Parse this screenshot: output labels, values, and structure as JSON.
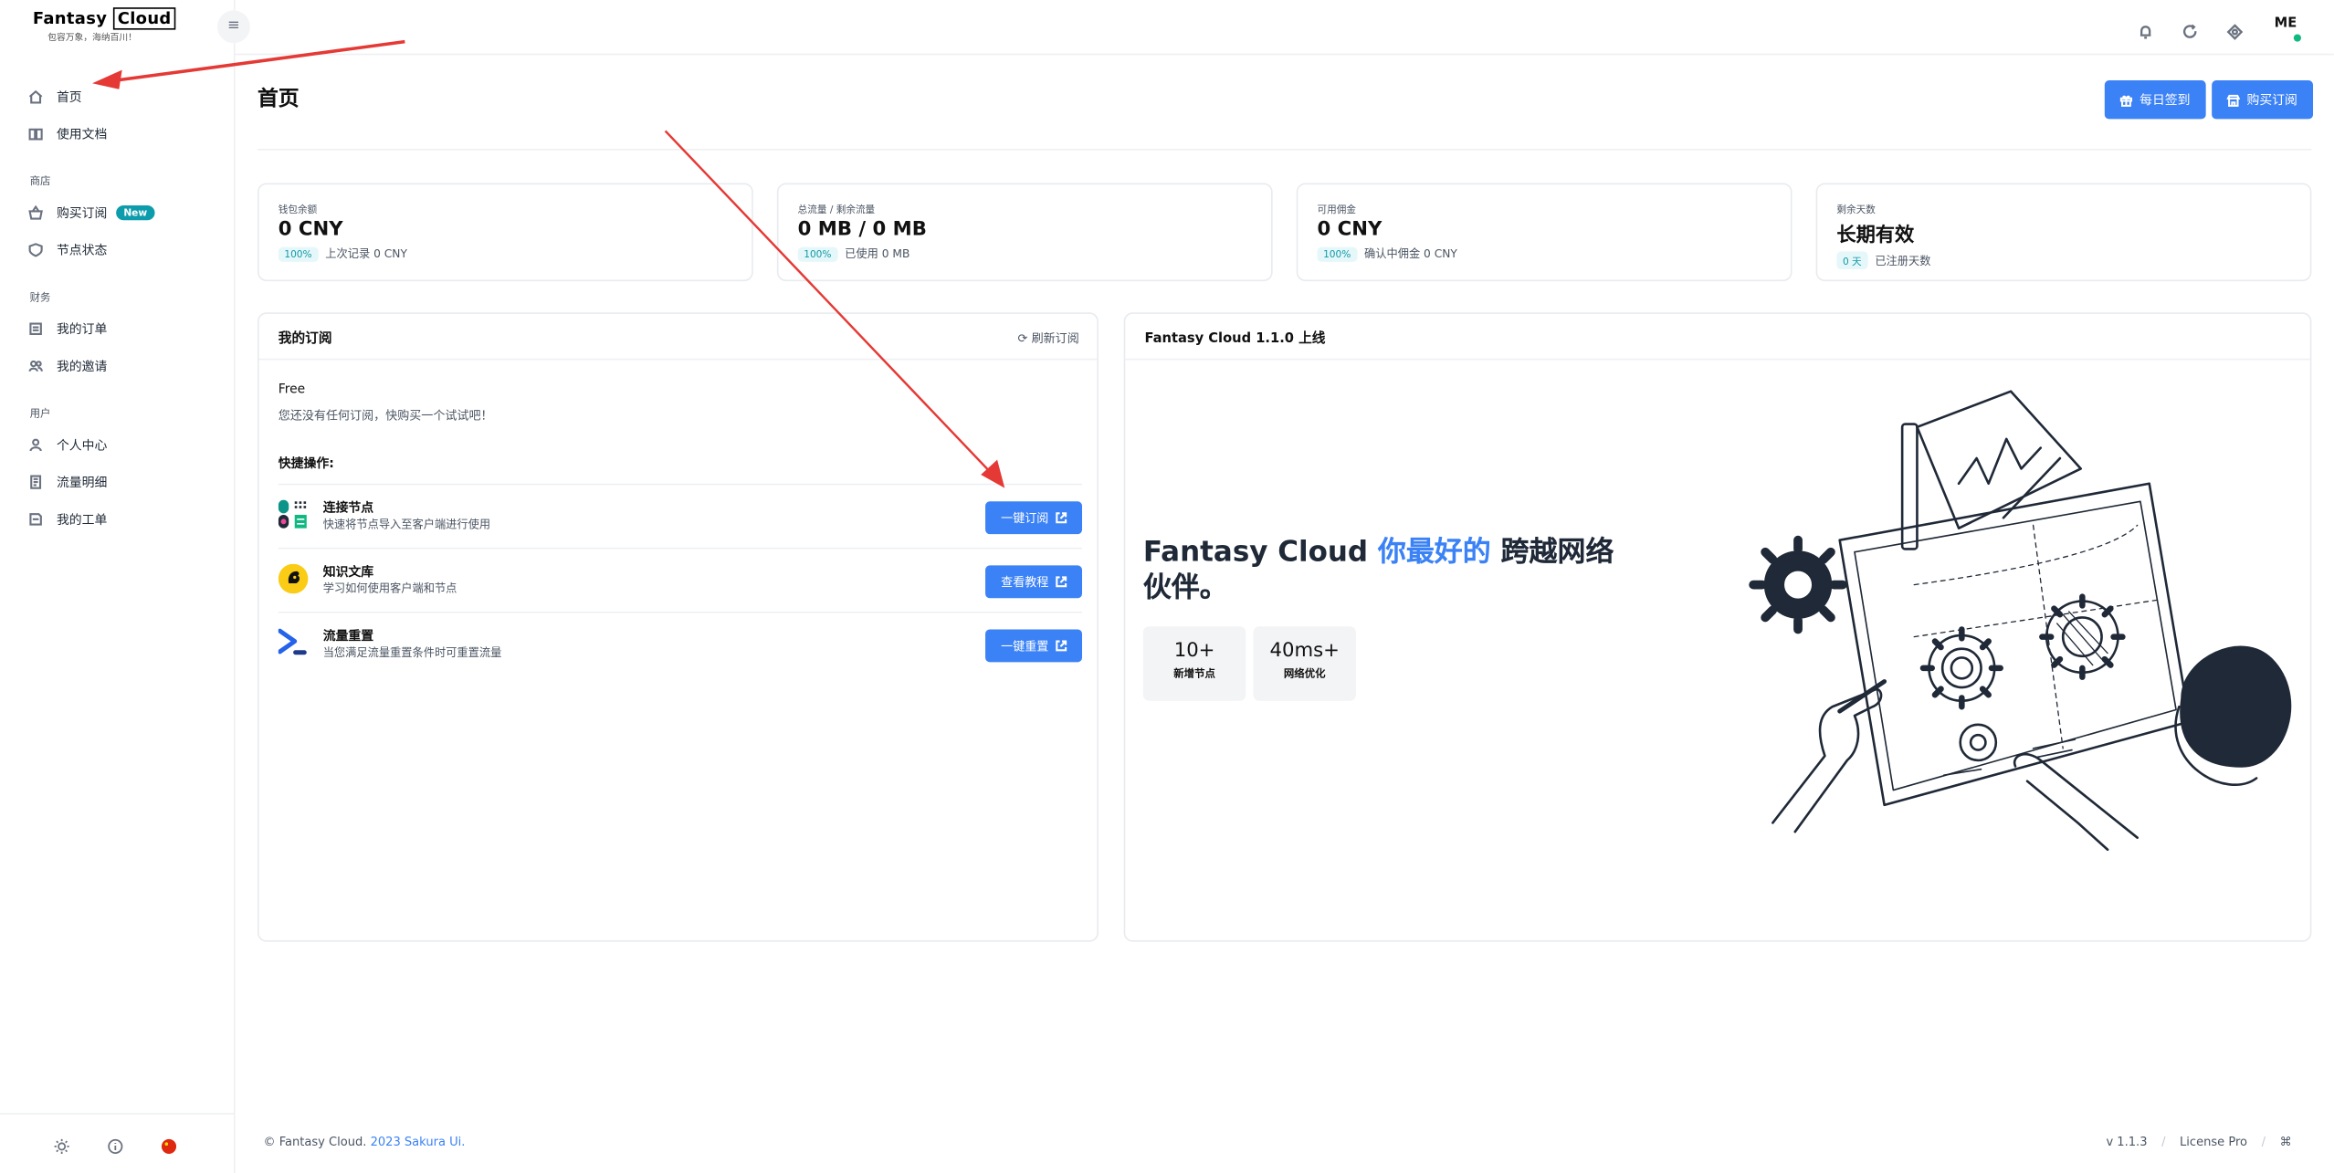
{
  "brand": {
    "name_a": "Fantasy",
    "name_b": "Cloud",
    "tagline": "包容万象，海纳百川！"
  },
  "nav": {
    "home": "首页",
    "docs": "使用文档",
    "sec_shop": "商店",
    "buy": "购买订阅",
    "buy_badge": "New",
    "nodes": "节点状态",
    "sec_finance": "财务",
    "orders": "我的订单",
    "invites": "我的邀请",
    "sec_user": "用户",
    "profile": "个人中心",
    "traffic": "流量明细",
    "tickets": "我的工单"
  },
  "topbar": {
    "avatar": "ME"
  },
  "page": {
    "title": "首页",
    "checkin": "每日签到",
    "subscribe": "购买订阅"
  },
  "stats": [
    {
      "label": "钱包余额",
      "value": "0 CNY",
      "pill": "100%",
      "sub": "上次记录 0 CNY"
    },
    {
      "label": "总流量 / 剩余流量",
      "value": "0 MB / 0 MB",
      "pill": "100%",
      "sub": "已使用 0 MB"
    },
    {
      "label": "可用佣金",
      "value": "0 CNY",
      "pill": "100%",
      "sub": "确认中佣金 0 CNY"
    },
    {
      "label": "剩余天数",
      "value": "长期有效",
      "pill": "0 天",
      "sub": "已注册天数"
    }
  ],
  "subscription": {
    "title": "我的订阅",
    "refresh": "刷新订阅",
    "plan": "Free",
    "empty": "您还没有任何订阅，快购买一个试试吧！",
    "quick": "快捷操作:",
    "actions": [
      {
        "title": "连接节点",
        "desc": "快速将节点导入至客户端进行使用",
        "btn": "一键订阅"
      },
      {
        "title": "知识文库",
        "desc": "学习如何使用客户端和节点",
        "btn": "查看教程"
      },
      {
        "title": "流量重置",
        "desc": "当您满足流量重置条件时可重置流量",
        "btn": "一键重置"
      }
    ]
  },
  "announce": {
    "title": "Fantasy Cloud 1.1.0 上线",
    "hero_a": "Fantasy Cloud ",
    "hero_hl": "你最好的",
    "hero_b": " 跨越网络伙伴。",
    "metrics": [
      {
        "num": "10+",
        "label": "新增节点"
      },
      {
        "num": "40ms+",
        "label": "网络优化"
      }
    ]
  },
  "footer": {
    "copy": "© Fantasy Cloud. ",
    "link": "2023 Sakura Ui.",
    "version": "v 1.1.3",
    "slash": "/",
    "license": "License Pro",
    "cmd": "⌘"
  },
  "colors": {
    "accent": "#3b82f6",
    "teal": "#0d9cac",
    "arrow": "#e53935"
  }
}
